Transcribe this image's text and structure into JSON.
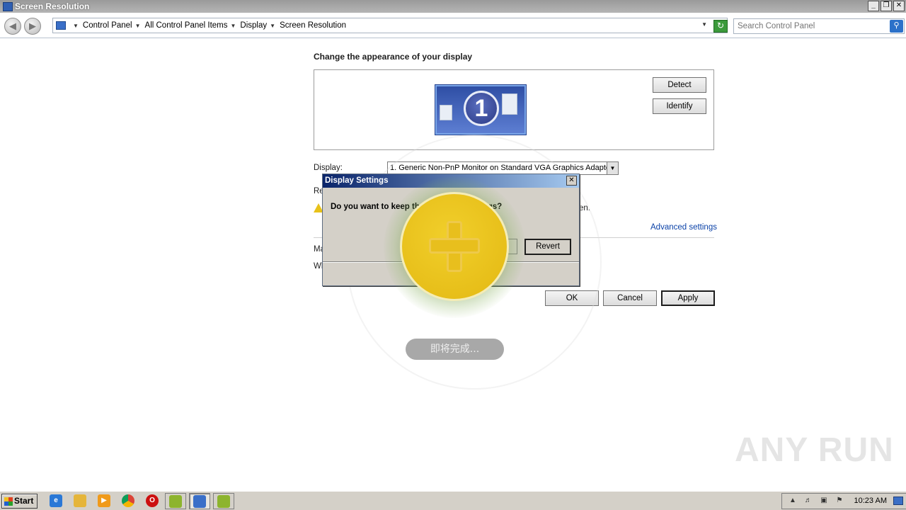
{
  "window": {
    "title": "Screen Resolution",
    "controls": [
      "_",
      "❐",
      "✕"
    ]
  },
  "address_bar": {
    "breadcrumbs": [
      "Control Panel",
      "All Control Panel Items",
      "Display",
      "Screen Resolution"
    ],
    "search_placeholder": "Search Control Panel"
  },
  "page": {
    "heading": "Change the appearance of your display",
    "monitor_number": "1",
    "detect_label": "Detect",
    "identify_label": "Identify",
    "display_label": "Display:",
    "display_value": "1. Generic Non-PnP Monitor on Standard VGA Graphics Adapter",
    "resolution_label_partial": "Re",
    "warning_text_partial": "en.",
    "advanced_link": "Advanced settings",
    "make_text_partial": "Ma",
    "what_text_partial": "Wl",
    "ok_label": "OK",
    "cancel_label": "Cancel",
    "apply_label": "Apply"
  },
  "dialog": {
    "title": "Display Settings",
    "message": "Do you want to keep these display settings?",
    "close_glyph": "✕",
    "revert_label": "Revert"
  },
  "overlay": {
    "progress_text": "即将完成..."
  },
  "watermark": "ANY RUN",
  "taskbar": {
    "start_label": "Start",
    "clock": "10:23 AM"
  },
  "icons": {
    "back": "back-arrow-icon",
    "forward": "forward-arrow-icon",
    "search": "search-icon",
    "refresh": "refresh-icon"
  }
}
